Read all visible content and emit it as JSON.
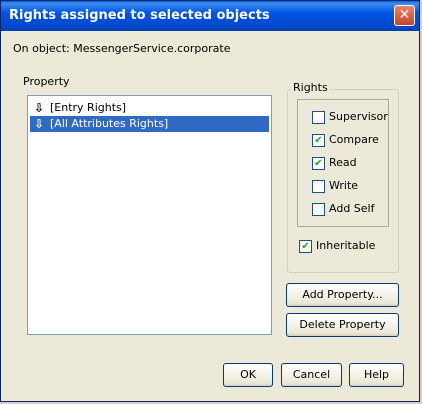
{
  "window": {
    "title": "Rights assigned to selected objects",
    "close_symbol": "✕"
  },
  "object_label": "On object: MessengerService.corporate",
  "property": {
    "label": "Property",
    "items": [
      {
        "label": "[Entry Rights]",
        "icon": "down-arrow-icon",
        "selected": false
      },
      {
        "label": "[All Attributes Rights]",
        "icon": "down-arrow-icon",
        "selected": true
      }
    ]
  },
  "rights": {
    "label": "Rights",
    "items": [
      {
        "label": "Supervisor",
        "checked": false
      },
      {
        "label": "Compare",
        "checked": true
      },
      {
        "label": "Read",
        "checked": true
      },
      {
        "label": "Write",
        "checked": false
      },
      {
        "label": "Add Self",
        "checked": false
      }
    ],
    "inheritable": {
      "label": "Inheritable",
      "checked": true
    }
  },
  "buttons": {
    "add_property": "Add Property...",
    "delete_property": "Delete Property",
    "ok": "OK",
    "cancel": "Cancel",
    "help": "Help"
  },
  "colors": {
    "selection": "#316ac5",
    "titlebar": "#0054e3",
    "check": "#21a121"
  }
}
